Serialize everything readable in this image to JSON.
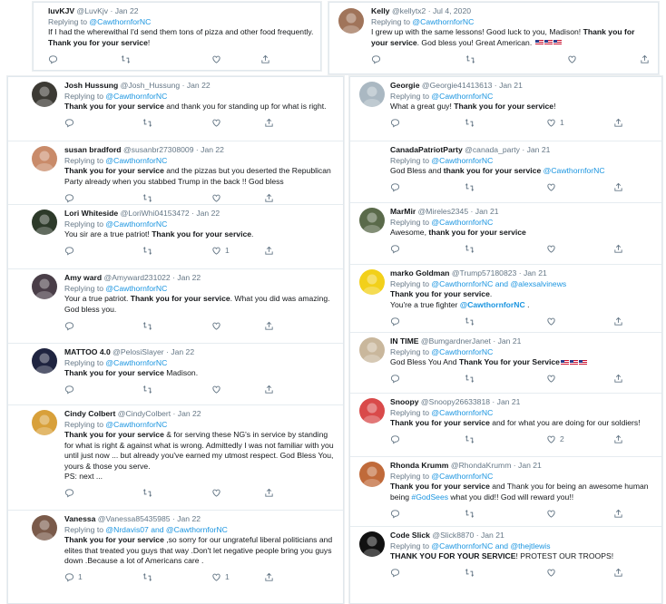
{
  "cards": [
    {
      "tweets": [
        {
          "name": "luvKJV",
          "handle": "@LuvKjv",
          "sep": " · ",
          "date": "Jan 22",
          "replying_prefix": "Replying to ",
          "replying_to": "@CawthornforNC",
          "text_before": "If I had the wherewithal I'd send them tons of pizza and other food frequently. ",
          "text_bold": "Thank you for your service",
          "text_after": "!",
          "reply_count": "",
          "like_count": ""
        }
      ]
    },
    {
      "tweets": [
        {
          "name": "Kelly",
          "handle": "@kellytx2",
          "sep": " · ",
          "date": "Jul 4, 2020",
          "replying_prefix": "Replying to ",
          "replying_to": "@CawthornforNC",
          "text_before": "I grew up with the same lessons! Good luck to you, Madison! ",
          "text_bold": "Thank you for your service",
          "text_after": ". God bless you! Great American. ",
          "flags": 3,
          "reply_count": "",
          "like_count": ""
        }
      ]
    },
    {
      "tweets": [
        {
          "name": "Josh Hussung",
          "handle": "@Josh_Hussung",
          "sep": " · ",
          "date": "Jan 22",
          "replying_prefix": "Replying to ",
          "replying_to": "@CawthornforNC",
          "text_bold": "Thank you for your service",
          "text_after": " and thank you for standing up for what is right.",
          "reply_count": "",
          "like_count": ""
        },
        {
          "name": "susan bradford",
          "handle": "@susanbr27308009",
          "sep": " · ",
          "date": "Jan 22",
          "replying_prefix": "Replying to ",
          "replying_to": "@CawthornforNC",
          "text_bold": "Thank you for your service",
          "text_after": " and the pizzas but you deserted the Republican Party already when you stabbed Trump in the back !! God bless",
          "reply_count": "",
          "like_count": ""
        },
        {
          "name": "Lori Whiteside",
          "handle": "@LoriWhi04153472",
          "sep": " · ",
          "date": "Jan 22",
          "replying_prefix": "Replying to ",
          "replying_to": "@CawthornforNC",
          "text_before": "You sir are a true patriot!  ",
          "text_bold": "Thank you for your service",
          "text_after": ".",
          "reply_count": "",
          "like_count": "1"
        },
        {
          "name": "Amy ward",
          "handle": "@Amyward231022",
          "sep": " · ",
          "date": "Jan 22",
          "replying_prefix": "Replying to ",
          "replying_to": "@CawthornforNC",
          "text_before": "Your a true patriot. ",
          "text_bold": "Thank you for your service",
          "text_after": ". What you did was amazing. God bless you.",
          "reply_count": "",
          "like_count": ""
        },
        {
          "name": "MATTOO 4.0",
          "handle": "@PelosiSlayer",
          "sep": " · ",
          "date": "Jan 22",
          "replying_prefix": "Replying to ",
          "replying_to": "@CawthornforNC",
          "text_bold": "Thank you for your service",
          "text_after": " Madison.",
          "reply_count": "",
          "like_count": ""
        },
        {
          "name": "Cindy Colbert",
          "handle": "@CindyColbert",
          "sep": " · ",
          "date": "Jan 22",
          "replying_prefix": "Replying to ",
          "replying_to": "@CawthornforNC",
          "text_bold": "Thank you for your service",
          "text_after": " & for serving these NG's in service by standing for what is right & against what is wrong. Admittedly I was not familiar with you until just now ... but already you've earned my utmost respect. God Bless You, yours & those you serve.",
          "text_extra": "PS: next ...",
          "reply_count": "",
          "like_count": ""
        },
        {
          "name": "Vanessa",
          "handle": "@Vanessa85435985",
          "sep": " · ",
          "date": "Jan 22",
          "replying_prefix": "Replying to ",
          "replying_to": "@Nrdavis07 and @CawthornforNC",
          "text_bold": "Thank you for your service",
          "text_after": " ,so sorry for our ungrateful liberal politicians and elites that treated you guys that way .Don't let negative people bring you guys down .Because a lot of Americans care .",
          "reply_count": "1",
          "like_count": "1"
        }
      ]
    },
    {
      "tweets": [
        {
          "name": "Georgie",
          "handle": "@Georgie41413613",
          "sep": " · ",
          "date": "Jan 21",
          "replying_prefix": "Replying to ",
          "replying_to": "@CawthornforNC",
          "text_before": "What a great guy!  ",
          "text_bold": "Thank you for your service",
          "text_after": "!",
          "reply_count": "",
          "like_count": "1"
        },
        {
          "name": "CanadaPatriotParty",
          "handle": "@canada_party",
          "sep": " · ",
          "date": "Jan 21",
          "replying_prefix": "Replying to ",
          "replying_to": "@CawthornforNC",
          "text_before": "God Bless and ",
          "text_bold": "thank you for your service",
          "text_link": " @CawthornforNC",
          "reply_count": "",
          "like_count": ""
        },
        {
          "name": "MarMir",
          "handle": "@Mireles2345",
          "sep": " · ",
          "date": "Jan 21",
          "replying_prefix": "Replying to ",
          "replying_to": "@CawthornforNC",
          "text_before": "Awesome, ",
          "text_bold": "thank you for your service",
          "reply_count": "",
          "like_count": ""
        },
        {
          "name": "marko Goldman",
          "handle": "@Trump57180823",
          "sep": " · ",
          "date": "Jan 21",
          "replying_prefix": "Replying to ",
          "replying_to": "@CawthornforNC and @alexsalvinews",
          "text_bold": "Thank you for your service",
          "text_after": ".",
          "text_extra": "You're a true fighter ",
          "text_extra_link": "@CawthornforNC",
          "text_extra_after": " .",
          "reply_count": "",
          "like_count": ""
        },
        {
          "name": "IN TIME",
          "handle": "@BumgardnerJanet",
          "sep": " · ",
          "date": "Jan 21",
          "replying_prefix": "Replying to ",
          "replying_to": "@CawthornforNC",
          "text_before": "God Bless You And ",
          "text_bold": "Thank You for your Service",
          "flags": 3,
          "reply_count": "",
          "like_count": ""
        },
        {
          "name": "Snoopy",
          "handle": "@Snoopy26633818",
          "sep": " · ",
          "date": "Jan 21",
          "replying_prefix": "Replying to ",
          "replying_to": "@CawthornforNC",
          "text_bold": "Thank you for your service",
          "text_after": " and for what you are doing for our soldiers!",
          "reply_count": "",
          "like_count": "2"
        },
        {
          "name": "Rhonda Krumm",
          "handle": "@RhondaKrumm",
          "sep": " · ",
          "date": "Jan 21",
          "replying_prefix": "Replying to ",
          "replying_to": "@CawthornforNC",
          "text_bold": "Thank you for your service",
          "text_after": " and Thank you for being an awesome human being ",
          "text_link": "#GodSees",
          "text_after2": " what you did!! God will reward you!!",
          "reply_count": "",
          "like_count": ""
        },
        {
          "name": "Code Slick",
          "handle": "@Slick8870",
          "sep": " · ",
          "date": "Jan 21",
          "replying_prefix": "Replying to ",
          "replying_to": "@CawthornforNC and @thejtlewis",
          "text_bold": "THANK YOU FOR YOUR SERVICE",
          "text_after": "! PROTEST OUR TROOPS!",
          "reply_count": "",
          "like_count": ""
        }
      ]
    }
  ],
  "avatar_colors": {
    "luvKJV": "",
    "Kelly": "#a0745a",
    "Josh Hussung": "#3c3a34",
    "susan bradford": "#c98b6a",
    "Lori Whiteside": "#2d3a2a",
    "Amy ward": "#4a3e48",
    "MATTOO 4.0": "#1f2440",
    "Cindy Colbert": "#d8a03a",
    "Vanessa": "#7a5a4a",
    "Georgie": "#aab8c2",
    "CanadaPatriotParty": "#ffffff",
    "MarMir": "#5a6a4a",
    "marko Goldman": "#f2d01a",
    "IN TIME": "#c9b79c",
    "Snoopy": "#d94a4a",
    "Rhonda Krumm": "#c06a3a",
    "Code Slick": "#111111"
  },
  "colors": {
    "link": "#1b95e0",
    "muted": "#657786",
    "text": "#14171a",
    "border": "#e1e8ed"
  },
  "icons": [
    "reply-icon",
    "retweet-icon",
    "like-icon",
    "share-icon"
  ]
}
